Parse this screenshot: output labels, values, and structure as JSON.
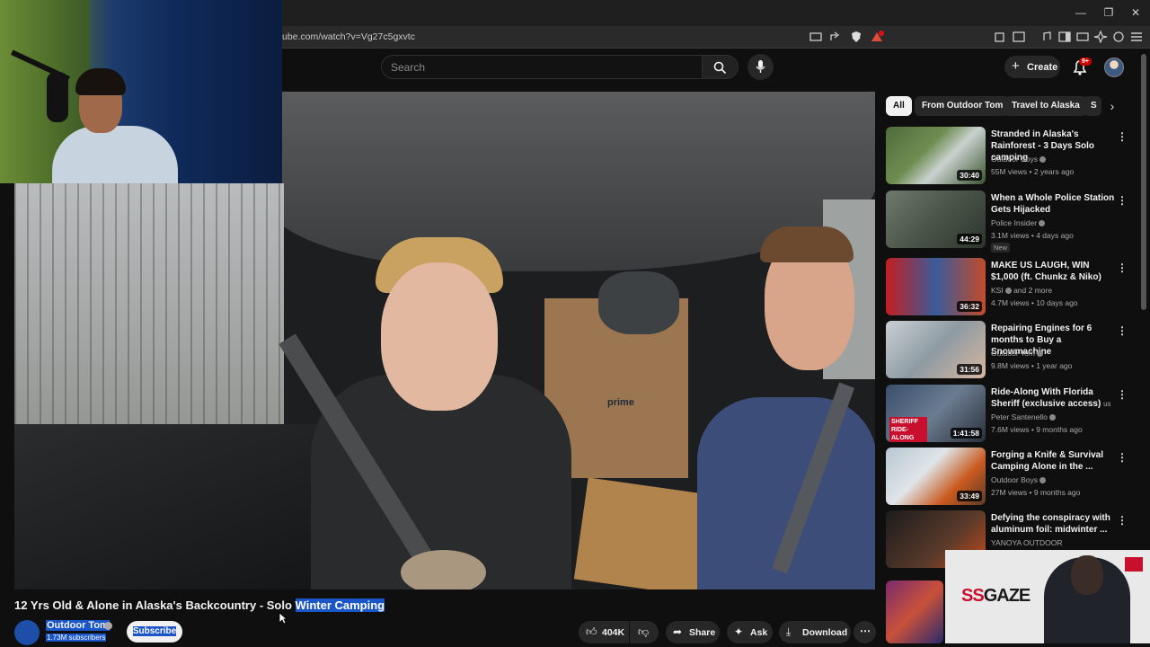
{
  "browser": {
    "url": "ube.com/watch?v=Vg27c5gxvtc",
    "ext_badge": "1"
  },
  "header": {
    "search_placeholder": "Search",
    "create_label": "Create",
    "notif_count": "9+"
  },
  "video": {
    "title_prefix": "12 Yrs Old & Alone in Alaska's Backcountry - Solo ",
    "title_highlight": "Winter Camping",
    "box_text": "prime",
    "channel": "Outdoor Tom",
    "subscribers": "1.73M subscribers",
    "subscribe_label": "Subscribe",
    "likes": "404K",
    "share_label": "Share",
    "ask_label": "Ask",
    "download_label": "Download"
  },
  "sidebar": {
    "chips": [
      "All",
      "From Outdoor Tom",
      "Travel to Alaska",
      "S"
    ],
    "recommendations": [
      {
        "title": "Stranded in Alaska's Rainforest - 3 Days Solo camping",
        "channel": "Outdoor Boys",
        "meta": "55M views • 2 years ago",
        "duration": "30:40",
        "verified": true
      },
      {
        "title": "When a Whole Police Station Gets Hijacked",
        "channel": "Police Insider",
        "meta": "3.1M views • 4 days ago",
        "badge": "New",
        "duration": "44:29",
        "verified": true
      },
      {
        "title": "MAKE US LAUGH, WIN $1,000 (ft. Chunkz & Niko)",
        "channel": "KSI",
        "channel_extra": "and 2 more",
        "meta": "4.7M views • 10 days ago",
        "duration": "36:32",
        "verified": true
      },
      {
        "title": "Repairing Engines for 6 months to Buy a Snowmachine",
        "channel": "Outdoor Tom",
        "meta": "9.8M views • 1 year ago",
        "duration": "31:56",
        "verified": true
      },
      {
        "title": "Ride-Along With Florida Sheriff (exclusive access)",
        "title_suffix": "us",
        "channel": "Peter Santenello",
        "meta": "7.6M views • 9 months ago",
        "duration": "1:41:58",
        "thumb_text": "SHERIFF RIDE-ALONG",
        "verified": true
      },
      {
        "title": "Forging a Knife & Survival Camping Alone in the ...",
        "channel": "Outdoor Boys",
        "meta": "27M views • 9 months ago",
        "duration": "33:49",
        "verified": true
      },
      {
        "title": "Defying the conspiracy with aluminum foil: midwinter ...",
        "channel": "YANOYA OUTDOOR",
        "meta": "",
        "duration": "",
        "verified": false
      }
    ]
  },
  "overlay": {
    "brand_ss": "SS",
    "brand_gaze": "GAZE"
  },
  "colors": {
    "background": "#0f0f0f",
    "selection": "#1a56c8",
    "notif_red": "#cc0000",
    "chip_bg": "#272727"
  }
}
